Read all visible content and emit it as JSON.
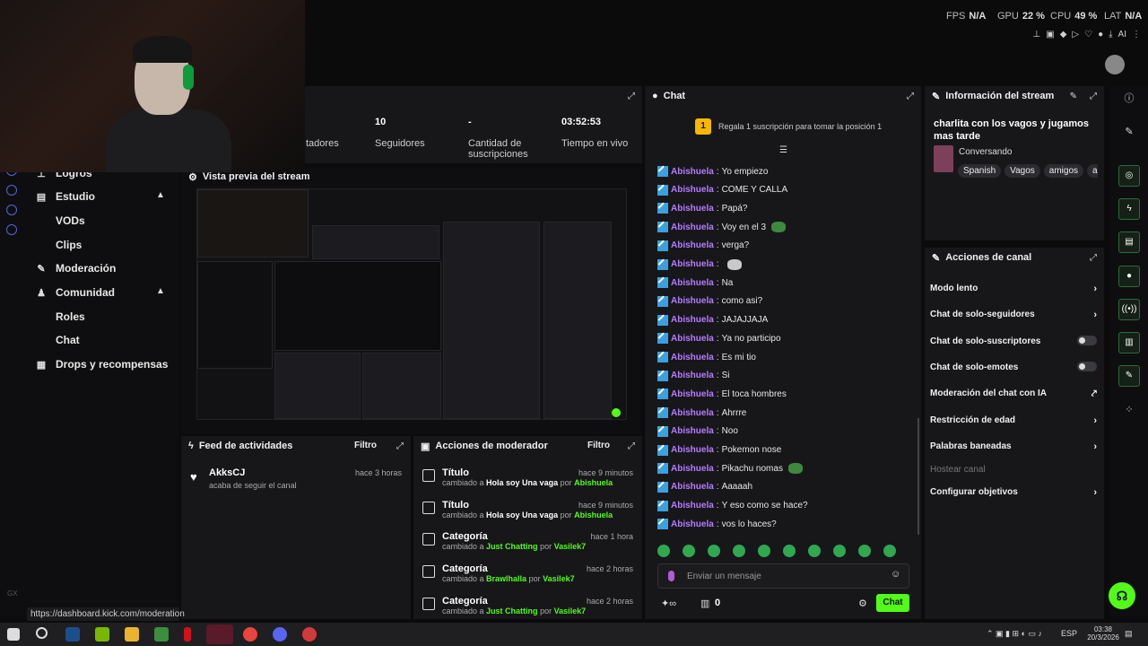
{
  "perf": {
    "fps_label": "FPS",
    "fps": "N/A",
    "gpu_label": "GPU",
    "gpu": "22 %",
    "cpu_label": "CPU",
    "cpu": "49 %",
    "lat_label": "LAT",
    "lat": "N/A",
    "ai": "AI"
  },
  "stats": {
    "followers_value": "10",
    "followers_label": "Seguidores",
    "subs_value": "-",
    "subs_label": "Cantidad de suscripciones",
    "live_value": "03:52:53",
    "live_label": "Tiempo en vivo",
    "spectators_partial": "tadores"
  },
  "sidebar": {
    "logros": "Logros",
    "estudio": "Estudio",
    "vods": "VODs",
    "clips": "Clips",
    "moderacion": "Moderación",
    "comunidad": "Comunidad",
    "roles": "Roles",
    "chat": "Chat",
    "drops": "Drops y recompensas",
    "gx": "GX"
  },
  "status_url": "https://dashboard.kick.com/moderation",
  "preview": {
    "title": "Vista previa del stream"
  },
  "feed": {
    "title": "Feed de actividades",
    "filter": "Filtro",
    "user": "AkksCJ",
    "action": "acaba de seguir el canal",
    "time": "hace 3 horas"
  },
  "modactions": {
    "title": "Acciones de moderador",
    "filter": "Filtro",
    "rows": [
      {
        "title": "Título",
        "pre": "cambiado a",
        "value": "Hola soy Una vaga",
        "by": "por",
        "user": "Abishuela",
        "time": "hace 9 minutos"
      },
      {
        "title": "Título",
        "pre": "cambiado a",
        "value": "Hola soy Una vaga",
        "by": "por",
        "user": "Abishuela",
        "time": "hace 9 minutos"
      },
      {
        "title": "Categoría",
        "pre": "cambiado a",
        "value": "Just Chatting",
        "by": "por",
        "user": "Vasilek7",
        "time": "hace 1 hora"
      },
      {
        "title": "Categoría",
        "pre": "cambiado a",
        "value": "Brawlhalla",
        "by": "por",
        "user": "Vasilek7",
        "time": "hace 2 horas"
      },
      {
        "title": "Categoría",
        "pre": "cambiado a",
        "value": "Just Chatting",
        "by": "por",
        "user": "Vasilek7",
        "time": "hace 2 horas"
      }
    ]
  },
  "chat": {
    "title": "Chat",
    "gift_rank": "1",
    "gift_text": "Regala 1 suscripción para tomar la posición 1",
    "user": "Abishuela",
    "messages": [
      "Yo empiezo",
      "COME Y CALLA",
      "Papá?",
      "Voy en el 3",
      "verga?",
      "",
      "Na",
      "como asi?",
      "JAJAJJAJA",
      "Ya no participo",
      "Es mi tio",
      "Si",
      "El toca hombres",
      "Ahrrre",
      "Noo",
      "Pokemon nose",
      "Pikachu nomas",
      "Aaaaah",
      "Y eso como se hace?",
      "vos lo haces?"
    ],
    "placeholder": "Enviar un mensaje",
    "count": "0",
    "send": "Chat"
  },
  "info": {
    "title": "Información del stream",
    "stream_title": "charlita con los vagos y jugamos mas tarde",
    "category": "Conversando",
    "tags": [
      "Spanish",
      "Vagos",
      "amigos",
      "ar"
    ]
  },
  "actions": {
    "title": "Acciones de canal",
    "items": [
      "Modo lento",
      "Chat de solo-seguidores",
      "Chat de solo-suscriptores",
      "Chat de solo-emotes",
      "Moderación del chat con IA",
      "Restricción de edad",
      "Palabras baneadas",
      "Hostear canal",
      "Configurar objetivos"
    ]
  },
  "taskbar": {
    "lang": "ESP",
    "time": "03:38",
    "date": "20/3/2026"
  }
}
